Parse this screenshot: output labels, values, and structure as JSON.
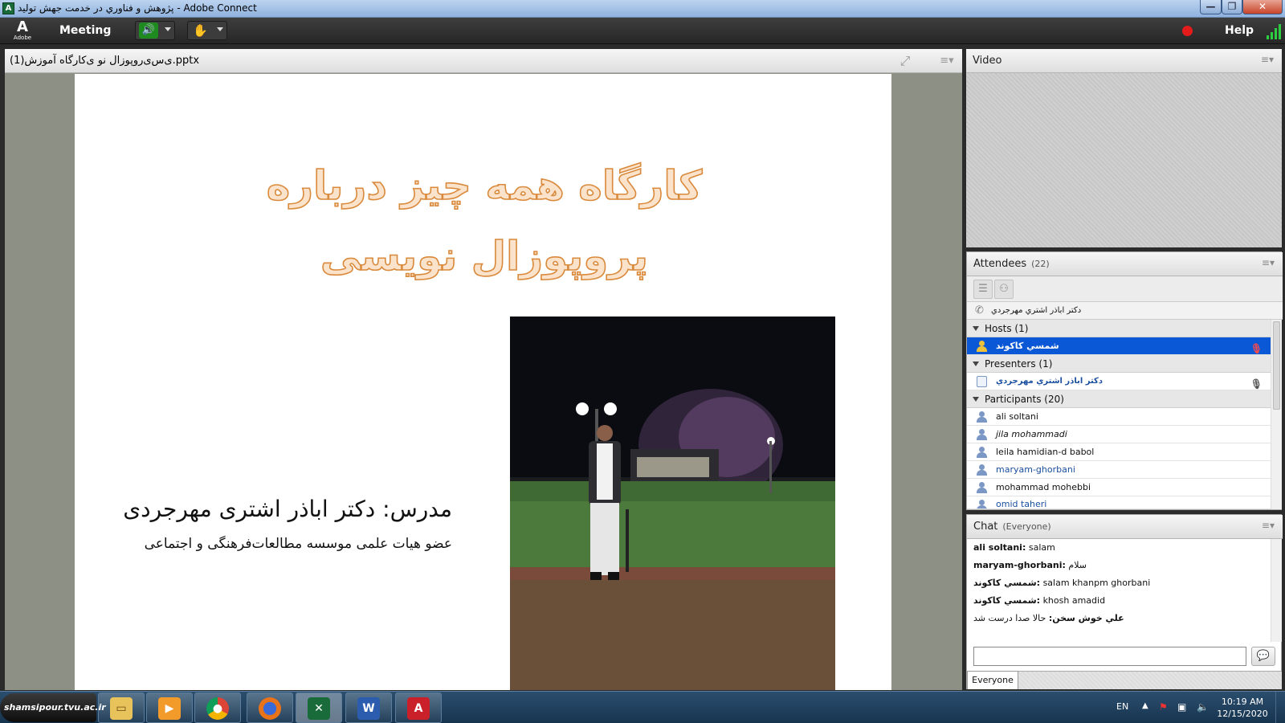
{
  "window": {
    "title": "پژوهش و فناوري در خدمت جهش توليد - Adobe Connect",
    "app_icon": "adobe-connect-icon",
    "min": "—",
    "max": "❐",
    "close": "✕"
  },
  "menubar": {
    "logo_text": "Adobe",
    "meeting": "Meeting",
    "help": "Help"
  },
  "share": {
    "title": "(1)ی‌س‌ی‌روپوزال نو ی‌کارگاه آموزش.pptx"
  },
  "slide": {
    "title_line1": "کارگاه همه چیز درباره",
    "title_line2": "پروپوزال نویسی",
    "instructor": "مدرس: دکتر اباذر اشتری مهرجردی",
    "affiliation": "عضو هیات علمی موسسه مطالعات‌فرهنگی و اجتماعی"
  },
  "video": {
    "title": "Video"
  },
  "attendees": {
    "title": "Attendees",
    "count": "(22)",
    "speaking": "دکتر اباذر اشتري مهرجردي",
    "groups": {
      "hosts": {
        "label": "Hosts (1)",
        "members": [
          "شمسي كاكوند"
        ]
      },
      "presenters": {
        "label": "Presenters (1)",
        "members": [
          "دكتر اباذر اشتري مهرجردي"
        ]
      },
      "participants": {
        "label": "Participants (20)",
        "members": [
          "ali soltani",
          "jila mohammadi",
          "leila hamidian-d  babol",
          "maryam-ghorbani",
          "mohammad mohebbi",
          "omid taheri"
        ]
      }
    }
  },
  "chat": {
    "title": "Chat",
    "scope": "(Everyone)",
    "messages": [
      {
        "user": "ali soltani:",
        "text": "salam"
      },
      {
        "user": "maryam-ghorbani:",
        "text": "سلام"
      },
      {
        "user": "شمسي كاكوند:",
        "text": "salam  khanpm ghorbani"
      },
      {
        "user": "شمسي كاكوند:",
        "text": "khosh amadid"
      },
      {
        "user": "علي خوش سخن:",
        "text": "حالا صدا درست شد"
      }
    ],
    "input_value": "",
    "tab": "Everyone"
  },
  "taskbar": {
    "start_label": "shamsipour.tvu.ac.ir",
    "apps": [
      "file-explorer-icon",
      "media-player-icon",
      "chrome-icon",
      "firefox-icon",
      "adobe-connect-icon",
      "word-icon",
      "acrobat-icon"
    ],
    "lang": "EN",
    "time": "10:19 AM",
    "date": "12/15/2020"
  },
  "colors": {
    "record": "#e31b1b",
    "host_selected": "#0a58d6",
    "presenter_text": "#1a4fa0",
    "title_fill": "#fbe2ca",
    "title_stroke": "#d98a3c"
  }
}
